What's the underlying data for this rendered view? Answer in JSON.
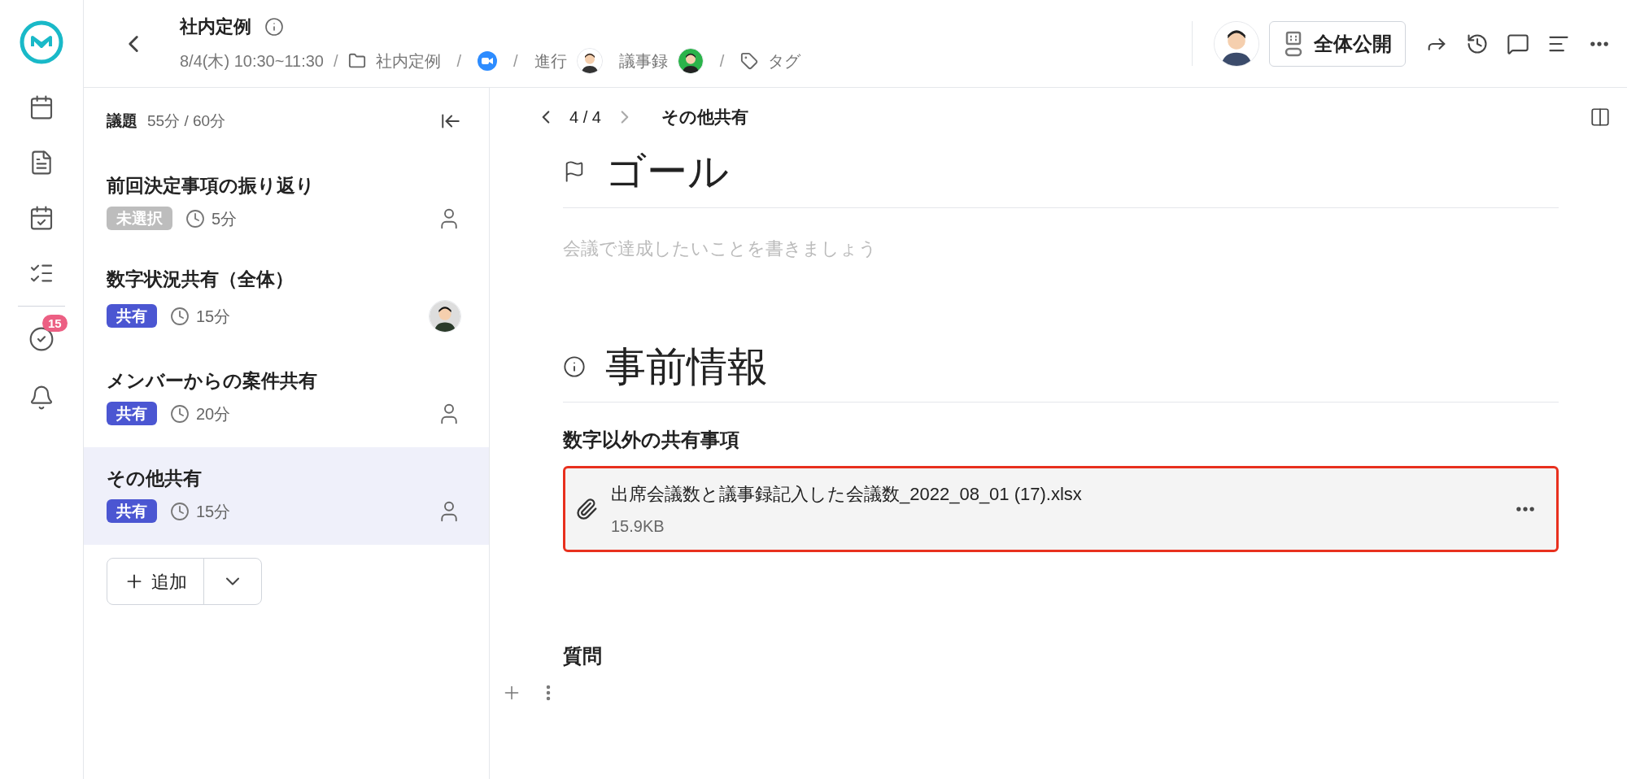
{
  "rail": {
    "notification_count": "15"
  },
  "header": {
    "separators": [
      "/",
      "/",
      "/",
      "/"
    ],
    "title": "社内定例",
    "datetime": "8/4(木) 10:30~11:30",
    "folder": "社内定例",
    "facilitator_label": "進行",
    "minutes_label": "議事録",
    "tag": "タグ",
    "publish_button": "全体公開"
  },
  "sidebar": {
    "title": "議題",
    "time": "55分 / 60分",
    "add_button": "追加",
    "items": [
      {
        "title": "前回決定事項の振り返り",
        "badge": {
          "label": "未選択",
          "kind": "unselected"
        },
        "duration": "5分",
        "assigned": false,
        "selected": false
      },
      {
        "title": "数字状況共有（全体）",
        "badge": {
          "label": "共有",
          "kind": "share"
        },
        "duration": "15分",
        "assigned": true,
        "selected": false
      },
      {
        "title": "メンバーからの案件共有",
        "badge": {
          "label": "共有",
          "kind": "share"
        },
        "duration": "20分",
        "assigned": false,
        "selected": false
      },
      {
        "title": "その他共有",
        "badge": {
          "label": "共有",
          "kind": "share"
        },
        "duration": "15分",
        "assigned": false,
        "selected": true
      }
    ]
  },
  "main": {
    "pager": "4 / 4",
    "topic": "その他共有",
    "goal": {
      "heading": "ゴール",
      "placeholder": "会議で達成したいことを書きましょう"
    },
    "info": {
      "heading": "事前情報",
      "subheading": "数字以外の共有事項",
      "attachment": {
        "name": "出席会議数と議事録記入した会議数_2022_08_01 (17).xlsx",
        "size": "15.9KB",
        "highlighted": true
      }
    },
    "question": {
      "heading": "質問"
    }
  }
}
